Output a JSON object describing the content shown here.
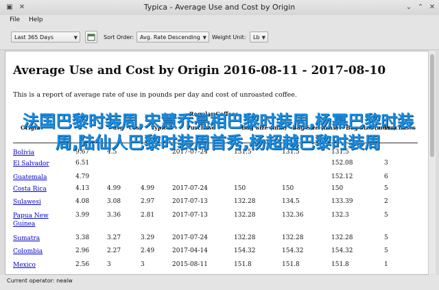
{
  "window": {
    "title": "Typica - Average Use and Cost by Origin"
  },
  "menu": {
    "file": "File",
    "help": "Help"
  },
  "toolbar": {
    "date_range": "Last 365 Days",
    "sort_label": "Sort Order:",
    "sort_value": "Avg. Rate Descending",
    "unit_label": "Weight Unit:",
    "unit_value": "Lb"
  },
  "report": {
    "title": "Average Use and Cost by Origin 2016-08-11 - 2017-08-10",
    "description": "This is a report of average rate of use in pounds per day and cost of unroasted coffee.",
    "header_group": "Regular Coffees",
    "headers": [
      "Origin",
      "avg",
      "cost",
      "Typical",
      "Purchase",
      "Bag Size (min)",
      "Bag Size (max)",
      "Bag Size (mean)",
      "Purchases"
    ],
    "rows": [
      {
        "origin": "Bolivia",
        "c1": "9.67",
        "c2": "4.5",
        "c3": "",
        "c4": "2017-07-24",
        "c5": "131.5",
        "c6": "131.5",
        "c7": "131.5",
        "c8": ""
      },
      {
        "origin": "El Salvador",
        "c1": "6.51",
        "c2": "",
        "c3": "",
        "c4": "",
        "c5": "",
        "c6": "",
        "c7": "152.08",
        "c8": "3"
      },
      {
        "origin": "Guatemala",
        "c1": "4.79",
        "c2": "",
        "c3": "",
        "c4": "",
        "c5": "",
        "c6": "",
        "c7": "152.12",
        "c8": "6"
      },
      {
        "origin": "Costa Rica",
        "c1": "4.13",
        "c2": "4.99",
        "c3": "4.99",
        "c4": "2017-07-24",
        "c5": "150",
        "c6": "150",
        "c7": "150",
        "c8": "5"
      },
      {
        "origin": "Sulawesi",
        "c1": "4.08",
        "c2": "3.08",
        "c3": "2.97",
        "c4": "2017-07-13",
        "c5": "132.28",
        "c6": "134.5",
        "c7": "133.39",
        "c8": "2"
      },
      {
        "origin": "Papua New Guinea",
        "c1": "3.99",
        "c2": "3.36",
        "c3": "2.81",
        "c4": "2017-07-13",
        "c5": "132.28",
        "c6": "132.36",
        "c7": "132.3",
        "c8": "5"
      },
      {
        "origin": "Sumatra",
        "c1": "3.38",
        "c2": "3.27",
        "c3": "3.29",
        "c4": "2017-07-24",
        "c5": "132.28",
        "c6": "132.28",
        "c7": "132.28",
        "c8": "5"
      },
      {
        "origin": "Colombia",
        "c1": "2.96",
        "c2": "2.27",
        "c3": "2.49",
        "c4": "2017-04-14",
        "c5": "154.32",
        "c6": "154.32",
        "c7": "154.32",
        "c8": "5"
      },
      {
        "origin": "Mexico",
        "c1": "2.56",
        "c2": "3",
        "c3": "3",
        "c4": "2015-08-11",
        "c5": "151.8",
        "c6": "151.8",
        "c7": "151.8",
        "c8": "1"
      }
    ]
  },
  "overlay_text": "法国巴黎时装周,宋慧乔亮相巴黎时装周,杨幂巴黎时装周,陆仙人巴黎时装周首秀,杨超越巴黎时装周",
  "status": {
    "operator": "Current operator: nealw"
  }
}
